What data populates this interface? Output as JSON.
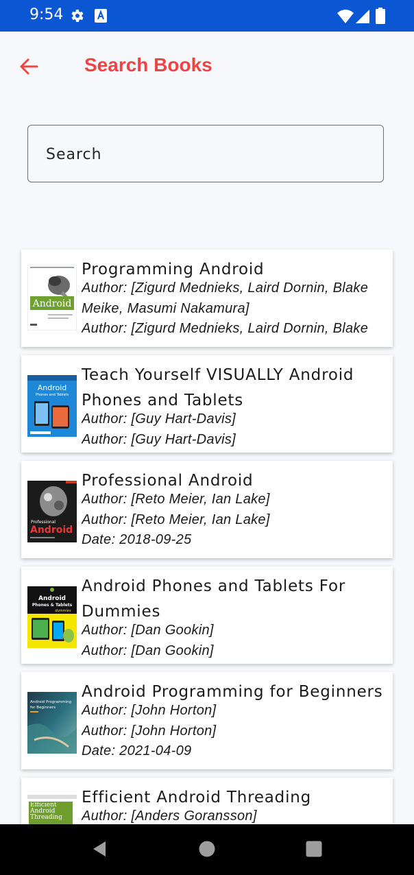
{
  "status_bar": {
    "time": "9:54",
    "icons": [
      "gear-icon",
      "font-a-icon",
      "wifi-icon",
      "signal-icon",
      "battery-icon"
    ],
    "background": "#0b56d2"
  },
  "app_bar": {
    "title": "Search Books",
    "back_icon": "arrow-left-icon",
    "accent": "#ef4444"
  },
  "search": {
    "placeholder": "Search",
    "value": ""
  },
  "books": [
    {
      "title": "Programming Android",
      "lines": [
        "Author: [Zigurd Mednieks, Laird Dornin, Blake Meike, Masumi Nakamura]",
        "Author: [Zigurd Mednieks, Laird Dornin, Blake"
      ],
      "cover": "programming-android-cover"
    },
    {
      "title": "Teach Yourself VISUALLY Android Phones and Tablets",
      "lines": [
        "Author: [Guy Hart-Davis]",
        "Author: [Guy Hart-Davis]"
      ],
      "cover": "teach-yourself-visually-cover"
    },
    {
      "title": "Professional Android",
      "lines": [
        "Author: [Reto Meier, Ian Lake]",
        "Author: [Reto Meier, Ian Lake]",
        "Date: 2018-09-25"
      ],
      "cover": "professional-android-cover"
    },
    {
      "title": "Android Phones and Tablets For Dummies",
      "lines": [
        "Author: [Dan Gookin]",
        "Author: [Dan Gookin]"
      ],
      "cover": "android-for-dummies-cover"
    },
    {
      "title": "Android Programming for Beginners",
      "lines": [
        "Author: [John Horton]",
        "Author: [John Horton]",
        "Date: 2021-04-09"
      ],
      "cover": "android-programming-beginners-cover"
    },
    {
      "title": "Efficient Android Threading",
      "lines": [
        "Author: [Anders Goransson]"
      ],
      "cover": "efficient-android-threading-cover"
    }
  ],
  "cover_texts": {
    "c1": "Android",
    "c2a": "Android",
    "c2b": "Phones and Tablets",
    "c3a": "Professional",
    "c3b": "Android",
    "c4a": "Android",
    "c4b": "Phones & Tablets",
    "c4c": "dummies",
    "c5a": "Android Programming",
    "c5b": "for Beginners",
    "c6": "Efficient Android Threading"
  },
  "nav_bar": {
    "icons": [
      "nav-back-icon",
      "nav-home-icon",
      "nav-recents-icon"
    ]
  }
}
